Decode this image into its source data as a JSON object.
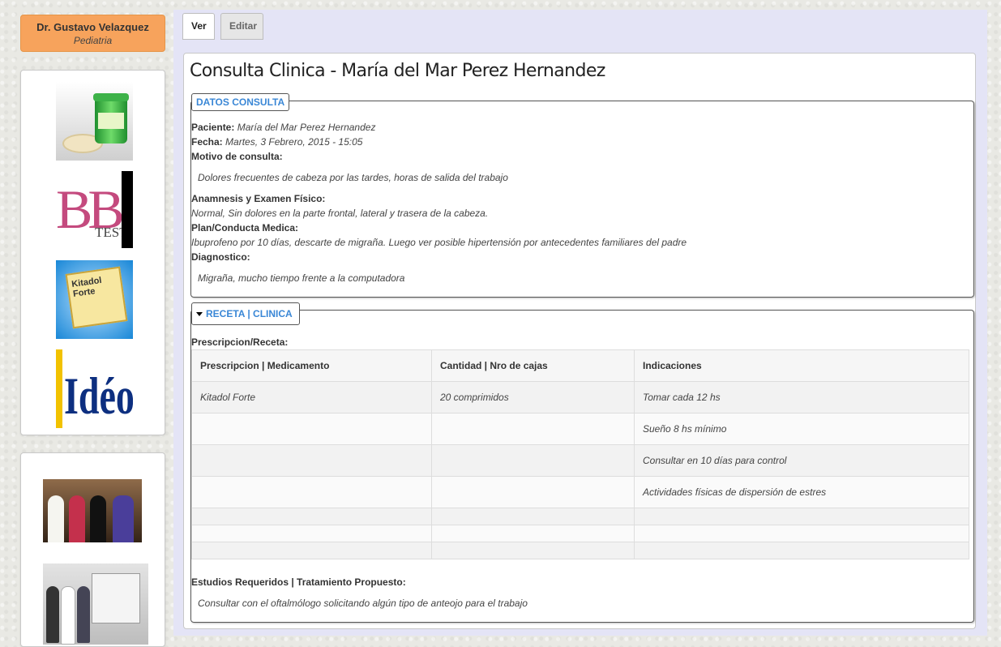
{
  "doctor": {
    "name": "Dr. Gustavo Velazquez",
    "specialty": "Pediatria"
  },
  "ads": {
    "bb_logo": "BB",
    "bb_test": "TEST",
    "kitadol_label": "Kitadol Forte",
    "ideos_logo": "Idéos"
  },
  "tabs": {
    "view": "Ver",
    "edit": "Editar"
  },
  "title": "Consulta Clinica - María del Mar Perez Hernandez",
  "datos": {
    "legend": "DATOS CONSULTA",
    "paciente_label": "Paciente:",
    "paciente": "María del Mar Perez Hernandez",
    "fecha_label": "Fecha:",
    "fecha": "Martes, 3 Febrero, 2015 - 15:05",
    "motivo_label": "Motivo de consulta:",
    "motivo": "Dolores frecuentes de cabeza por las tardes, horas de salida del trabajo",
    "anamnesis_label": "Anamnesis y Examen Físico:",
    "anamnesis": "Normal, Sin dolores en la parte frontal, lateral y trasera de la cabeza.",
    "plan_label": "Plan/Conducta Medica:",
    "plan": "Ibuprofeno por 10 días, descarte de migraña. Luego ver posible hipertensión por antecedentes familiares del padre",
    "diagnostico_label": "Diagnostico:",
    "diagnostico": "Migraña, mucho tiempo frente a la computadora"
  },
  "receta": {
    "legend": "RECETA | CLINICA",
    "prescripcion_label": "Prescripcion/Receta:",
    "headers": [
      "Prescripcion | Medicamento",
      "Cantidad | Nro de cajas",
      "Indicaciones"
    ],
    "rows": [
      [
        "Kitadol Forte",
        "20 comprimidos",
        "Tomar cada 12 hs"
      ],
      [
        "",
        "",
        "Sueño 8 hs mínimo"
      ],
      [
        "",
        "",
        "Consultar en 10 días para control"
      ],
      [
        "",
        "",
        "Actividades físicas de dispersión de estres"
      ],
      [
        "",
        "",
        ""
      ],
      [
        "",
        "",
        ""
      ],
      [
        "",
        "",
        ""
      ]
    ],
    "estudios_label": "Estudios Requeridos | Tratamiento Propuesto:",
    "estudios": "Consultar con el oftalmólogo solicitando algún tipo de anteojo para el trabajo"
  }
}
